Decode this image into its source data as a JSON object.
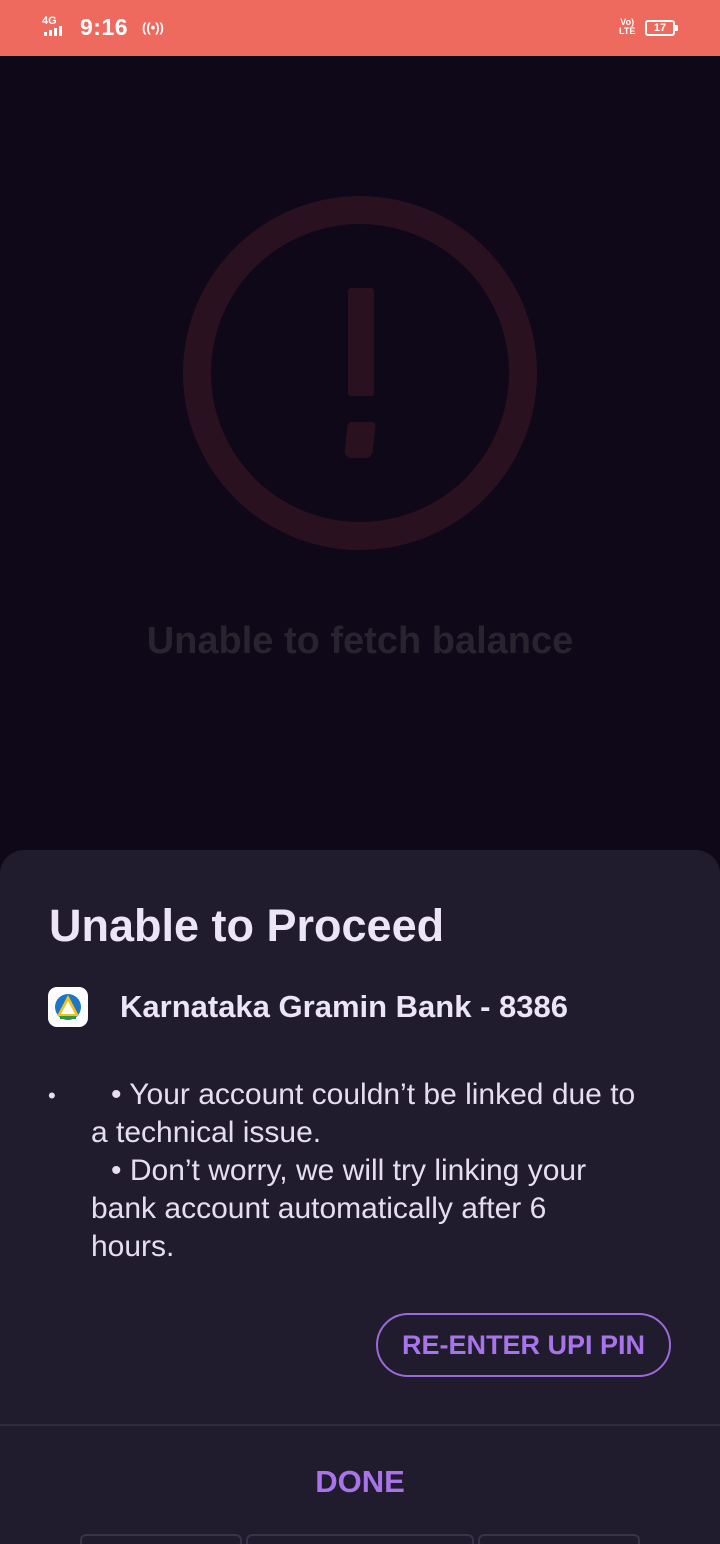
{
  "status_bar": {
    "network": "4G",
    "time": "9:16",
    "hotspot_icon": "hotspot-icon",
    "volte_top": "Vo)",
    "volte_bottom": "LTE",
    "battery": "17"
  },
  "background": {
    "icon": "exclamation-circle-icon",
    "title": "Unable to fetch balance"
  },
  "sheet": {
    "title": "Unable to Proceed",
    "bank_icon": "bank-logo-icon",
    "bank_name": "Karnataka Gramin Bank - 8386",
    "bullet": "•",
    "message_lines": [
      "• Your account couldn’t be linked due to",
      "a technical issue.",
      "• Don’t worry, we will try linking your",
      "bank account automatically after 6",
      "hours."
    ],
    "reenter_label": "RE-ENTER UPI PIN",
    "done_label": "DONE"
  },
  "colors": {
    "status_bar": "#ee6a5e",
    "background": "#0e0818",
    "sheet": "#211b2e",
    "accent": "#a874ea"
  }
}
